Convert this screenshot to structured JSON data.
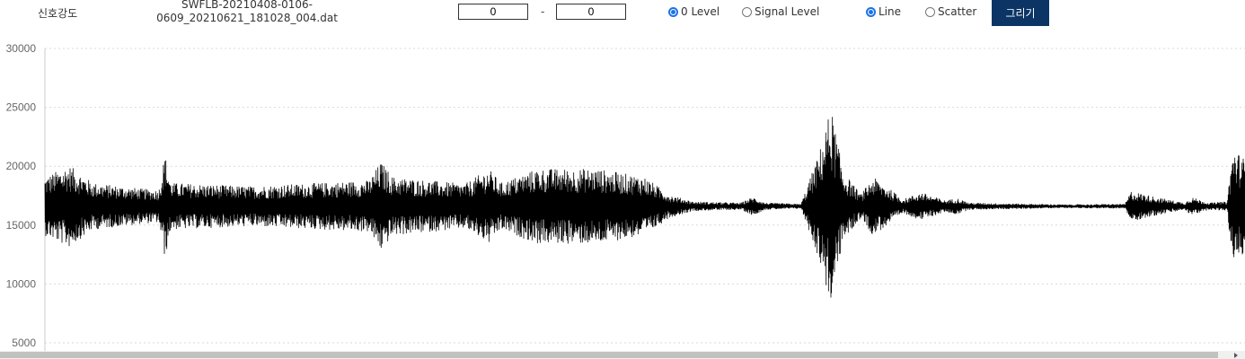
{
  "header": {
    "signal_label": "신호강도",
    "file_name_line1": "SWFLB-20210408-0106-",
    "file_name_line2": "0609_20210621_181028_004.dat",
    "range_from": "0",
    "range_dash": "-",
    "range_to": "0",
    "level_options": [
      {
        "label": "0 Level",
        "checked": true
      },
      {
        "label": "Signal Level",
        "checked": false
      }
    ],
    "plot_options": [
      {
        "label": "Line",
        "checked": true
      },
      {
        "label": "Scatter",
        "checked": false
      }
    ],
    "draw_label": "그리기"
  },
  "colors": {
    "accent": "#1a73e8",
    "button_bg": "#0c3566",
    "line": "#000000",
    "grid": "#d9d9d9"
  },
  "chart_data": {
    "type": "line",
    "title": "",
    "xlabel": "",
    "ylabel": "",
    "ylim": [
      5000,
      30000
    ],
    "yticks": [
      "30000",
      "25000",
      "20000",
      "15000",
      "10000",
      "5000"
    ],
    "grid": "horizontal dashed",
    "baseline": 16600,
    "envelope": [
      {
        "x": 0.0,
        "amp": 2500
      },
      {
        "x": 0.02,
        "amp": 3500
      },
      {
        "x": 0.04,
        "amp": 2000
      },
      {
        "x": 0.08,
        "amp": 1500
      },
      {
        "x": 0.095,
        "amp": 1400
      },
      {
        "x": 0.1,
        "amp": 4500
      },
      {
        "x": 0.105,
        "amp": 2000
      },
      {
        "x": 0.17,
        "amp": 1700
      },
      {
        "x": 0.27,
        "amp": 2200
      },
      {
        "x": 0.28,
        "amp": 3800
      },
      {
        "x": 0.29,
        "amp": 2500
      },
      {
        "x": 0.35,
        "amp": 1900
      },
      {
        "x": 0.37,
        "amp": 3200
      },
      {
        "x": 0.38,
        "amp": 2000
      },
      {
        "x": 0.41,
        "amp": 3200
      },
      {
        "x": 0.46,
        "amp": 3200
      },
      {
        "x": 0.5,
        "amp": 2500
      },
      {
        "x": 0.52,
        "amp": 1000
      },
      {
        "x": 0.54,
        "amp": 400
      },
      {
        "x": 0.58,
        "amp": 300
      },
      {
        "x": 0.59,
        "amp": 800
      },
      {
        "x": 0.6,
        "amp": 300
      },
      {
        "x": 0.63,
        "amp": 200
      },
      {
        "x": 0.645,
        "amp": 4500
      },
      {
        "x": 0.655,
        "amp": 8500
      },
      {
        "x": 0.665,
        "amp": 3000
      },
      {
        "x": 0.68,
        "amp": 1000
      },
      {
        "x": 0.69,
        "amp": 2500
      },
      {
        "x": 0.7,
        "amp": 1800
      },
      {
        "x": 0.715,
        "amp": 600
      },
      {
        "x": 0.73,
        "amp": 1200
      },
      {
        "x": 0.75,
        "amp": 500
      },
      {
        "x": 0.76,
        "amp": 700
      },
      {
        "x": 0.77,
        "amp": 300
      },
      {
        "x": 0.85,
        "amp": 150
      },
      {
        "x": 0.9,
        "amp": 200
      },
      {
        "x": 0.905,
        "amp": 1300
      },
      {
        "x": 0.93,
        "amp": 700
      },
      {
        "x": 0.95,
        "amp": 300
      },
      {
        "x": 0.955,
        "amp": 800
      },
      {
        "x": 0.97,
        "amp": 300
      },
      {
        "x": 0.985,
        "amp": 400
      },
      {
        "x": 0.99,
        "amp": 5000
      },
      {
        "x": 1.0,
        "amp": 4000
      }
    ]
  }
}
